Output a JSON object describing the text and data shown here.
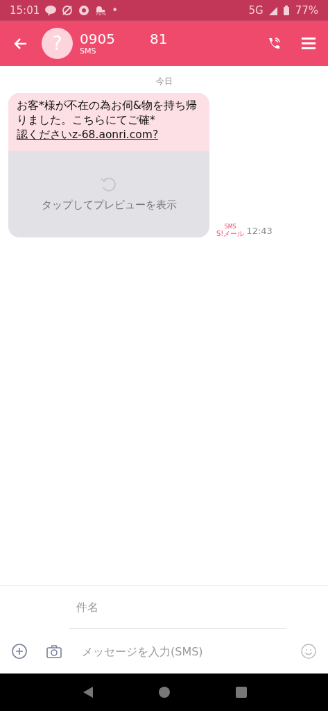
{
  "status_bar": {
    "time": "15:01",
    "weather_reading": "70%",
    "dot": "•",
    "network": "5G",
    "battery": "77%"
  },
  "header": {
    "number_start": "0905",
    "number_end": "81",
    "avatar": "?",
    "service": "SMS"
  },
  "conversation": {
    "date": "今日",
    "messages": [
      {
        "text": "お客*様が不在の為お伺&物を持ち帰りました。こちらにてご確*",
        "link": "認くださいz-68.aonri.com?",
        "preview": "タップしてプレビューを表示",
        "service": "SMS",
        "service_sub": "S!メール",
        "time": "12:43"
      }
    ]
  },
  "compose": {
    "subject_placeholder": "件名",
    "message_placeholder": "メッセージを入力(SMS)"
  }
}
